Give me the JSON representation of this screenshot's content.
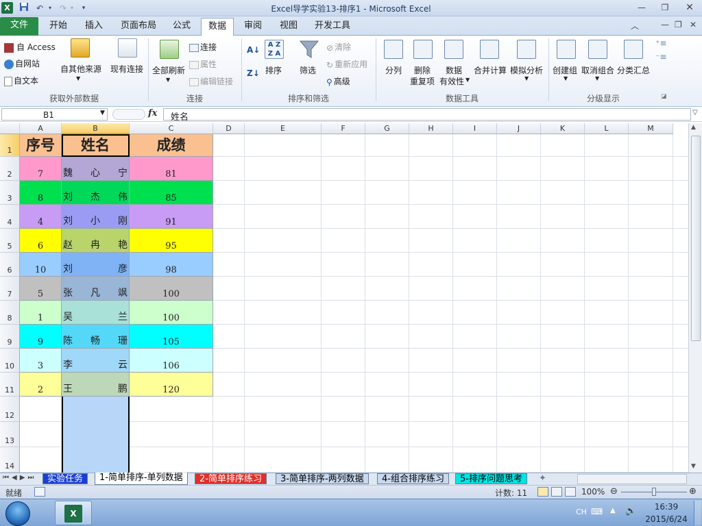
{
  "window": {
    "title": "Excel导学实验13-排序1  -  Microsoft Excel",
    "logo": "X",
    "qat": {
      "save_icon": "save-icon",
      "undo_icon": "undo-icon",
      "redo_icon": "redo-icon",
      "customize_icon": "customize-qat-icon"
    },
    "controls": [
      "minimize",
      "restore",
      "close"
    ]
  },
  "ribbon_tabs": [
    "文件",
    "开始",
    "插入",
    "页面布局",
    "公式",
    "数据",
    "审阅",
    "视图",
    "开发工具"
  ],
  "active_tab": "数据",
  "ribbon": {
    "get_external": {
      "access": "自 Access",
      "web": "自网站",
      "text": "自文本",
      "other": "自其他来源",
      "existing": "现有连接",
      "label": "获取外部数据"
    },
    "connections": {
      "refresh_all": "全部刷新",
      "connections": "连接",
      "properties": "属性",
      "edit_links": "编辑链接",
      "label": "连接"
    },
    "sort_filter": {
      "sort": "排序",
      "filter": "筛选",
      "clear": "清除",
      "reapply": "重新应用",
      "advanced": "高级",
      "label": "排序和筛选"
    },
    "data_tools": {
      "text_to_cols": "分列",
      "remove_dup_1": "删除",
      "remove_dup_2": "重复项",
      "validation_1": "数据",
      "validation_2": "有效性",
      "consolidate": "合并计算",
      "whatif": "模拟分析",
      "label": "数据工具"
    },
    "outline": {
      "group": "创建组",
      "ungroup": "取消组合",
      "subtotal": "分类汇总",
      "label": "分级显示"
    }
  },
  "formula_bar": {
    "name_box": "B1",
    "fx": "fx",
    "content": "姓名"
  },
  "columns": [
    "A",
    "B",
    "C",
    "D",
    "E",
    "F",
    "G",
    "H",
    "I",
    "J",
    "K",
    "L",
    "M"
  ],
  "row_numbers": [
    "1",
    "2",
    "3",
    "4",
    "5",
    "6",
    "7",
    "8",
    "9",
    "10",
    "11",
    "12",
    "13",
    "14"
  ],
  "headers": {
    "a": "序号",
    "b": "姓名",
    "c": "成绩"
  },
  "rows": [
    {
      "id": "7",
      "name": "魏心宁",
      "score": "81",
      "a_color": "#ff99cc",
      "b_color": "#b4a7d6",
      "c_color": "#ff99cc"
    },
    {
      "id": "8",
      "name": "刘杰伟",
      "score": "85",
      "a_color": "#00e04f",
      "b_color": "#00d85a",
      "c_color": "#00e04f"
    },
    {
      "id": "4",
      "name": "刘小刚",
      "score": "91",
      "a_color": "#c89bf4",
      "b_color": "#9a9cf4",
      "c_color": "#c89bf4"
    },
    {
      "id": "6",
      "name": "赵冉艳",
      "score": "95",
      "a_color": "#ffff00",
      "b_color": "#b8d46a",
      "c_color": "#ffff00"
    },
    {
      "id": "10",
      "name": "刘彦",
      "score": "98",
      "a_color": "#99ccff",
      "b_color": "#7fb3f5",
      "c_color": "#99ccff"
    },
    {
      "id": "5",
      "name": "张凡飒",
      "score": "100",
      "a_color": "#c0c0c0",
      "b_color": "#9ab6d6",
      "c_color": "#c0c0c0"
    },
    {
      "id": "1",
      "name": "吴兰",
      "score": "100",
      "a_color": "#ccffcc",
      "b_color": "#a9e0d8",
      "c_color": "#ccffcc"
    },
    {
      "id": "9",
      "name": "陈畅珊",
      "score": "105",
      "a_color": "#00ffff",
      "b_color": "#54d8f8",
      "c_color": "#00ffff"
    },
    {
      "id": "3",
      "name": "李云",
      "score": "106",
      "a_color": "#ccffff",
      "b_color": "#9fd8f8",
      "c_color": "#ccffff"
    },
    {
      "id": "2",
      "name": "王鹏",
      "score": "120",
      "a_color": "#ffff99",
      "b_color": "#bcd8b8",
      "c_color": "#ffff99"
    }
  ],
  "header_color": "#fac090",
  "selection_color": "#b8d7f8",
  "sheet_tabs": [
    {
      "label": "实验任务",
      "bg": "#1a3fd0",
      "fg": "#ffffff"
    },
    {
      "label": "1-简单排序-单列数据",
      "bg": "#ffffff",
      "fg": "#000000",
      "active": true
    },
    {
      "label": "2-简单排序练习",
      "bg": "#e0302a",
      "fg": "#ffffff"
    },
    {
      "label": "3-简单排序-两列数据",
      "bg": "#c8d8ee",
      "fg": "#000000"
    },
    {
      "label": "4-组合排序练习",
      "bg": "#c8d8ee",
      "fg": "#000000"
    },
    {
      "label": "5-排序问题思考",
      "bg": "#00e5e5",
      "fg": "#000000"
    }
  ],
  "status": {
    "ready": "就绪",
    "count": "计数: 11",
    "zoom": "100%"
  },
  "taskbar": {
    "lang": "CH",
    "time": "16:39",
    "date": "2015/6/24"
  }
}
